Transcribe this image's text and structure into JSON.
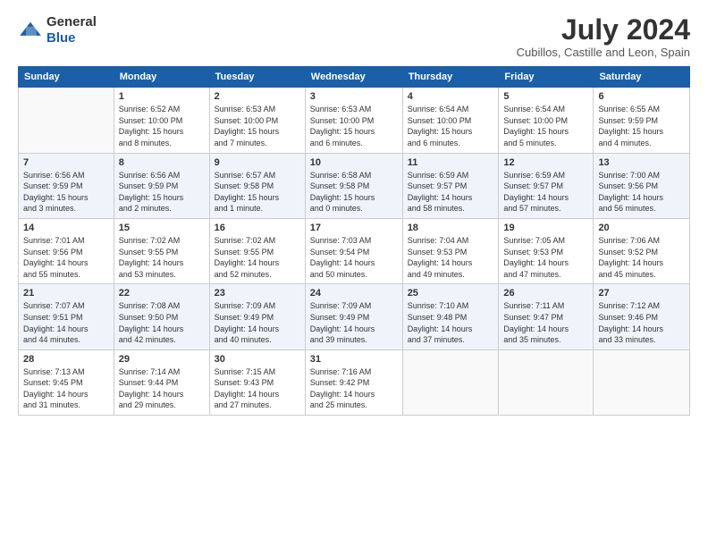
{
  "logo": {
    "general": "General",
    "blue": "Blue"
  },
  "title": "July 2024",
  "location": "Cubillos, Castille and Leon, Spain",
  "weekdays": [
    "Sunday",
    "Monday",
    "Tuesday",
    "Wednesday",
    "Thursday",
    "Friday",
    "Saturday"
  ],
  "weeks": [
    [
      {
        "day": "",
        "info": ""
      },
      {
        "day": "1",
        "info": "Sunrise: 6:52 AM\nSunset: 10:00 PM\nDaylight: 15 hours\nand 8 minutes."
      },
      {
        "day": "2",
        "info": "Sunrise: 6:53 AM\nSunset: 10:00 PM\nDaylight: 15 hours\nand 7 minutes."
      },
      {
        "day": "3",
        "info": "Sunrise: 6:53 AM\nSunset: 10:00 PM\nDaylight: 15 hours\nand 6 minutes."
      },
      {
        "day": "4",
        "info": "Sunrise: 6:54 AM\nSunset: 10:00 PM\nDaylight: 15 hours\nand 6 minutes."
      },
      {
        "day": "5",
        "info": "Sunrise: 6:54 AM\nSunset: 10:00 PM\nDaylight: 15 hours\nand 5 minutes."
      },
      {
        "day": "6",
        "info": "Sunrise: 6:55 AM\nSunset: 9:59 PM\nDaylight: 15 hours\nand 4 minutes."
      }
    ],
    [
      {
        "day": "7",
        "info": "Sunrise: 6:56 AM\nSunset: 9:59 PM\nDaylight: 15 hours\nand 3 minutes."
      },
      {
        "day": "8",
        "info": "Sunrise: 6:56 AM\nSunset: 9:59 PM\nDaylight: 15 hours\nand 2 minutes."
      },
      {
        "day": "9",
        "info": "Sunrise: 6:57 AM\nSunset: 9:58 PM\nDaylight: 15 hours\nand 1 minute."
      },
      {
        "day": "10",
        "info": "Sunrise: 6:58 AM\nSunset: 9:58 PM\nDaylight: 15 hours\nand 0 minutes."
      },
      {
        "day": "11",
        "info": "Sunrise: 6:59 AM\nSunset: 9:57 PM\nDaylight: 14 hours\nand 58 minutes."
      },
      {
        "day": "12",
        "info": "Sunrise: 6:59 AM\nSunset: 9:57 PM\nDaylight: 14 hours\nand 57 minutes."
      },
      {
        "day": "13",
        "info": "Sunrise: 7:00 AM\nSunset: 9:56 PM\nDaylight: 14 hours\nand 56 minutes."
      }
    ],
    [
      {
        "day": "14",
        "info": "Sunrise: 7:01 AM\nSunset: 9:56 PM\nDaylight: 14 hours\nand 55 minutes."
      },
      {
        "day": "15",
        "info": "Sunrise: 7:02 AM\nSunset: 9:55 PM\nDaylight: 14 hours\nand 53 minutes."
      },
      {
        "day": "16",
        "info": "Sunrise: 7:02 AM\nSunset: 9:55 PM\nDaylight: 14 hours\nand 52 minutes."
      },
      {
        "day": "17",
        "info": "Sunrise: 7:03 AM\nSunset: 9:54 PM\nDaylight: 14 hours\nand 50 minutes."
      },
      {
        "day": "18",
        "info": "Sunrise: 7:04 AM\nSunset: 9:53 PM\nDaylight: 14 hours\nand 49 minutes."
      },
      {
        "day": "19",
        "info": "Sunrise: 7:05 AM\nSunset: 9:53 PM\nDaylight: 14 hours\nand 47 minutes."
      },
      {
        "day": "20",
        "info": "Sunrise: 7:06 AM\nSunset: 9:52 PM\nDaylight: 14 hours\nand 45 minutes."
      }
    ],
    [
      {
        "day": "21",
        "info": "Sunrise: 7:07 AM\nSunset: 9:51 PM\nDaylight: 14 hours\nand 44 minutes."
      },
      {
        "day": "22",
        "info": "Sunrise: 7:08 AM\nSunset: 9:50 PM\nDaylight: 14 hours\nand 42 minutes."
      },
      {
        "day": "23",
        "info": "Sunrise: 7:09 AM\nSunset: 9:49 PM\nDaylight: 14 hours\nand 40 minutes."
      },
      {
        "day": "24",
        "info": "Sunrise: 7:09 AM\nSunset: 9:49 PM\nDaylight: 14 hours\nand 39 minutes."
      },
      {
        "day": "25",
        "info": "Sunrise: 7:10 AM\nSunset: 9:48 PM\nDaylight: 14 hours\nand 37 minutes."
      },
      {
        "day": "26",
        "info": "Sunrise: 7:11 AM\nSunset: 9:47 PM\nDaylight: 14 hours\nand 35 minutes."
      },
      {
        "day": "27",
        "info": "Sunrise: 7:12 AM\nSunset: 9:46 PM\nDaylight: 14 hours\nand 33 minutes."
      }
    ],
    [
      {
        "day": "28",
        "info": "Sunrise: 7:13 AM\nSunset: 9:45 PM\nDaylight: 14 hours\nand 31 minutes."
      },
      {
        "day": "29",
        "info": "Sunrise: 7:14 AM\nSunset: 9:44 PM\nDaylight: 14 hours\nand 29 minutes."
      },
      {
        "day": "30",
        "info": "Sunrise: 7:15 AM\nSunset: 9:43 PM\nDaylight: 14 hours\nand 27 minutes."
      },
      {
        "day": "31",
        "info": "Sunrise: 7:16 AM\nSunset: 9:42 PM\nDaylight: 14 hours\nand 25 minutes."
      },
      {
        "day": "",
        "info": ""
      },
      {
        "day": "",
        "info": ""
      },
      {
        "day": "",
        "info": ""
      }
    ]
  ]
}
